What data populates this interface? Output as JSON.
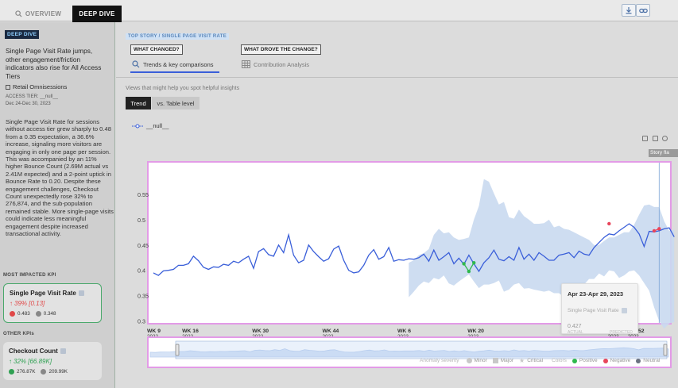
{
  "top": {
    "tabs": [
      {
        "label": "OVERVIEW"
      },
      {
        "label": "DEEP DIVE"
      }
    ],
    "icons": [
      "download-icon",
      "link-icon"
    ]
  },
  "left": {
    "badge": "DEEP DIVE",
    "headline": "Single Page Visit Rate jumps, other engagement/friction indicators also rise for All Access Tiers",
    "dimension": "Retail Omnisessions",
    "filter": "ACCESS TIER: __null__",
    "date_range": "Dec 24-Dec 30, 2023",
    "summary": "Single Page Visit Rate for sessions without access tier grew sharply to 0.48 from a 0.35 expectation, a 36.6% increase, signaling more visitors are engaging in only one page per session. This was accompanied by an 11% higher Bounce Count (2.69M actual vs 2.41M expected) and a 2-point uptick in Bounce Rate to 0.20. Despite these engagement challenges, Checkout Count unexpectedly rose 32% to 276,874, and the sub-population remained stable. More single-page visits could indicate less meaningful engagement despite increased transactional activity.",
    "most_impacted_title": "MOST IMPACTED KPI",
    "kpi1": {
      "name": "Single Page Visit Rate",
      "change": "39% [0.13]",
      "actual": "0.483",
      "expected": "0.348"
    },
    "other_title": "OTHER KPIs",
    "kpi2": {
      "name": "Checkout Count",
      "change": "32% [66.89K]",
      "actual": "276.87K",
      "expected": "209.99K"
    }
  },
  "main": {
    "top_story": "TOP STORY / SINGLE PAGE VISIT RATE",
    "q1": "WHAT CHANGED?",
    "q2": "WHAT DROVE THE CHANGE?",
    "tab1": "Trends & key comparisons",
    "tab2": "Contribution Analysis",
    "hint": "Views that might help you spot helpful insights",
    "view_trend": "Trend",
    "view_table": "vs. Table level",
    "series_legend": "__null__",
    "story_flag": "Story fla",
    "tooltip": {
      "date": "Apr 23-Apr 29, 2023",
      "metric": "Single Page Visit Rate",
      "actual_value": "0.427",
      "actual_label": "ACTUAL",
      "predicted_label": "PREDICTED"
    },
    "legend": {
      "anomaly_severity": "Anomaly severity",
      "minor": "Minor",
      "major": "Major",
      "critical": "Critical",
      "colors": "Colors",
      "positive": "Positive",
      "negative": "Negative",
      "neutral": "Neutral"
    },
    "accent": "#3a5fd9",
    "band": "#c9d9f0",
    "positive_color": "#2fb84d",
    "negative_color": "#e8455b"
  },
  "chart_data": {
    "type": "line",
    "title": "",
    "xlabel": "",
    "ylabel": "",
    "ylim": [
      0.29,
      0.6
    ],
    "yticks": [
      0.55,
      0.5,
      0.45,
      0.4,
      0.35,
      0.3
    ],
    "x_ticks": [
      {
        "index": 0,
        "label": "WK 9",
        "year": "2022"
      },
      {
        "index": 7,
        "label": "WK 16",
        "year": "2022"
      },
      {
        "index": 21,
        "label": "WK 30",
        "year": "2022"
      },
      {
        "index": 35,
        "label": "WK 44",
        "year": "2022"
      },
      {
        "index": 50,
        "label": "WK 6",
        "year": "2023"
      },
      {
        "index": 64,
        "label": "WK 20",
        "year": "2023"
      },
      {
        "index": 92,
        "label": "WK 48",
        "year": "2023"
      },
      {
        "index": 96,
        "label": "WK 52",
        "year": "2023"
      }
    ],
    "series": [
      {
        "values": [
          0.395,
          0.39,
          0.399,
          0.4,
          0.402,
          0.41,
          0.41,
          0.413,
          0.428,
          0.419,
          0.406,
          0.402,
          0.407,
          0.406,
          0.412,
          0.41,
          0.418,
          0.415,
          0.422,
          0.428,
          0.404,
          0.437,
          0.443,
          0.431,
          0.428,
          0.45,
          0.435,
          0.47,
          0.43,
          0.415,
          0.42,
          0.45,
          0.437,
          0.427,
          0.418,
          0.423,
          0.442,
          0.448,
          0.42,
          0.4,
          0.395,
          0.397,
          0.41,
          0.43,
          0.441,
          0.422,
          0.427,
          0.445,
          0.418,
          0.421,
          0.42,
          0.423,
          0.422,
          0.425,
          0.432,
          0.418,
          0.44,
          0.42,
          0.427,
          0.435,
          0.413,
          0.424,
          0.412,
          0.43,
          0.413,
          0.398,
          0.415,
          0.425,
          0.44,
          0.422,
          0.419,
          0.427,
          0.42,
          0.445,
          0.422,
          0.432,
          0.42,
          0.435,
          0.428,
          0.42,
          0.42,
          0.43,
          0.432,
          0.435,
          0.425,
          0.438,
          0.432,
          0.43,
          0.445,
          0.455,
          0.465,
          0.472,
          0.47,
          0.478,
          0.485,
          0.492,
          0.485,
          0.472,
          0.447,
          0.477,
          0.476,
          0.478,
          0.482,
          0.484,
          0.466
        ],
        "band_lower": [
          0.347,
          0.358,
          0.37,
          0.378,
          0.375,
          0.385,
          0.382,
          0.39,
          0.374,
          0.37,
          0.378,
          0.385,
          0.392,
          0.378,
          0.365,
          0.372,
          0.372,
          0.375,
          0.38,
          0.358,
          0.362,
          0.372,
          0.375,
          0.364,
          0.365,
          0.362,
          0.36,
          0.358,
          0.36,
          0.355,
          0.355,
          0.348,
          0.344,
          0.352,
          0.36,
          0.372,
          0.383,
          0.383,
          0.394,
          0.388,
          0.4,
          0.398,
          0.385,
          0.39,
          0.398,
          0.4,
          0.39,
          0.375,
          0.36,
          0.327,
          0.3,
          0.285,
          0.295,
          0.298
        ],
        "band_upper": [
          0.415,
          0.42,
          0.43,
          0.434,
          0.442,
          0.47,
          0.482,
          0.473,
          0.475,
          0.465,
          0.46,
          0.462,
          0.465,
          0.5,
          0.527,
          0.58,
          0.575,
          0.552,
          0.53,
          0.535,
          0.505,
          0.502,
          0.52,
          0.507,
          0.5,
          0.492,
          0.492,
          0.493,
          0.5,
          0.485,
          0.488,
          0.482,
          0.48,
          0.475,
          0.47,
          0.465,
          0.46,
          0.45,
          0.45,
          0.458,
          0.465,
          0.465,
          0.47,
          0.475,
          0.475,
          0.49,
          0.51,
          0.528,
          0.53,
          0.525,
          0.525,
          0.497,
          0.478,
          0.48
        ],
        "band_start_index": 51,
        "anomalies": [
          {
            "index": 62,
            "value": 0.413,
            "color": "positive"
          },
          {
            "index": 63,
            "value": 0.398,
            "color": "positive"
          },
          {
            "index": 64,
            "value": 0.415,
            "color": "positive"
          },
          {
            "index": 91,
            "value": 0.492,
            "color": "negative"
          },
          {
            "index": 100,
            "value": 0.478,
            "color": "negative"
          },
          {
            "index": 101,
            "value": 0.482,
            "color": "negative"
          }
        ]
      }
    ],
    "grid": false,
    "legend": "bottom-right"
  }
}
